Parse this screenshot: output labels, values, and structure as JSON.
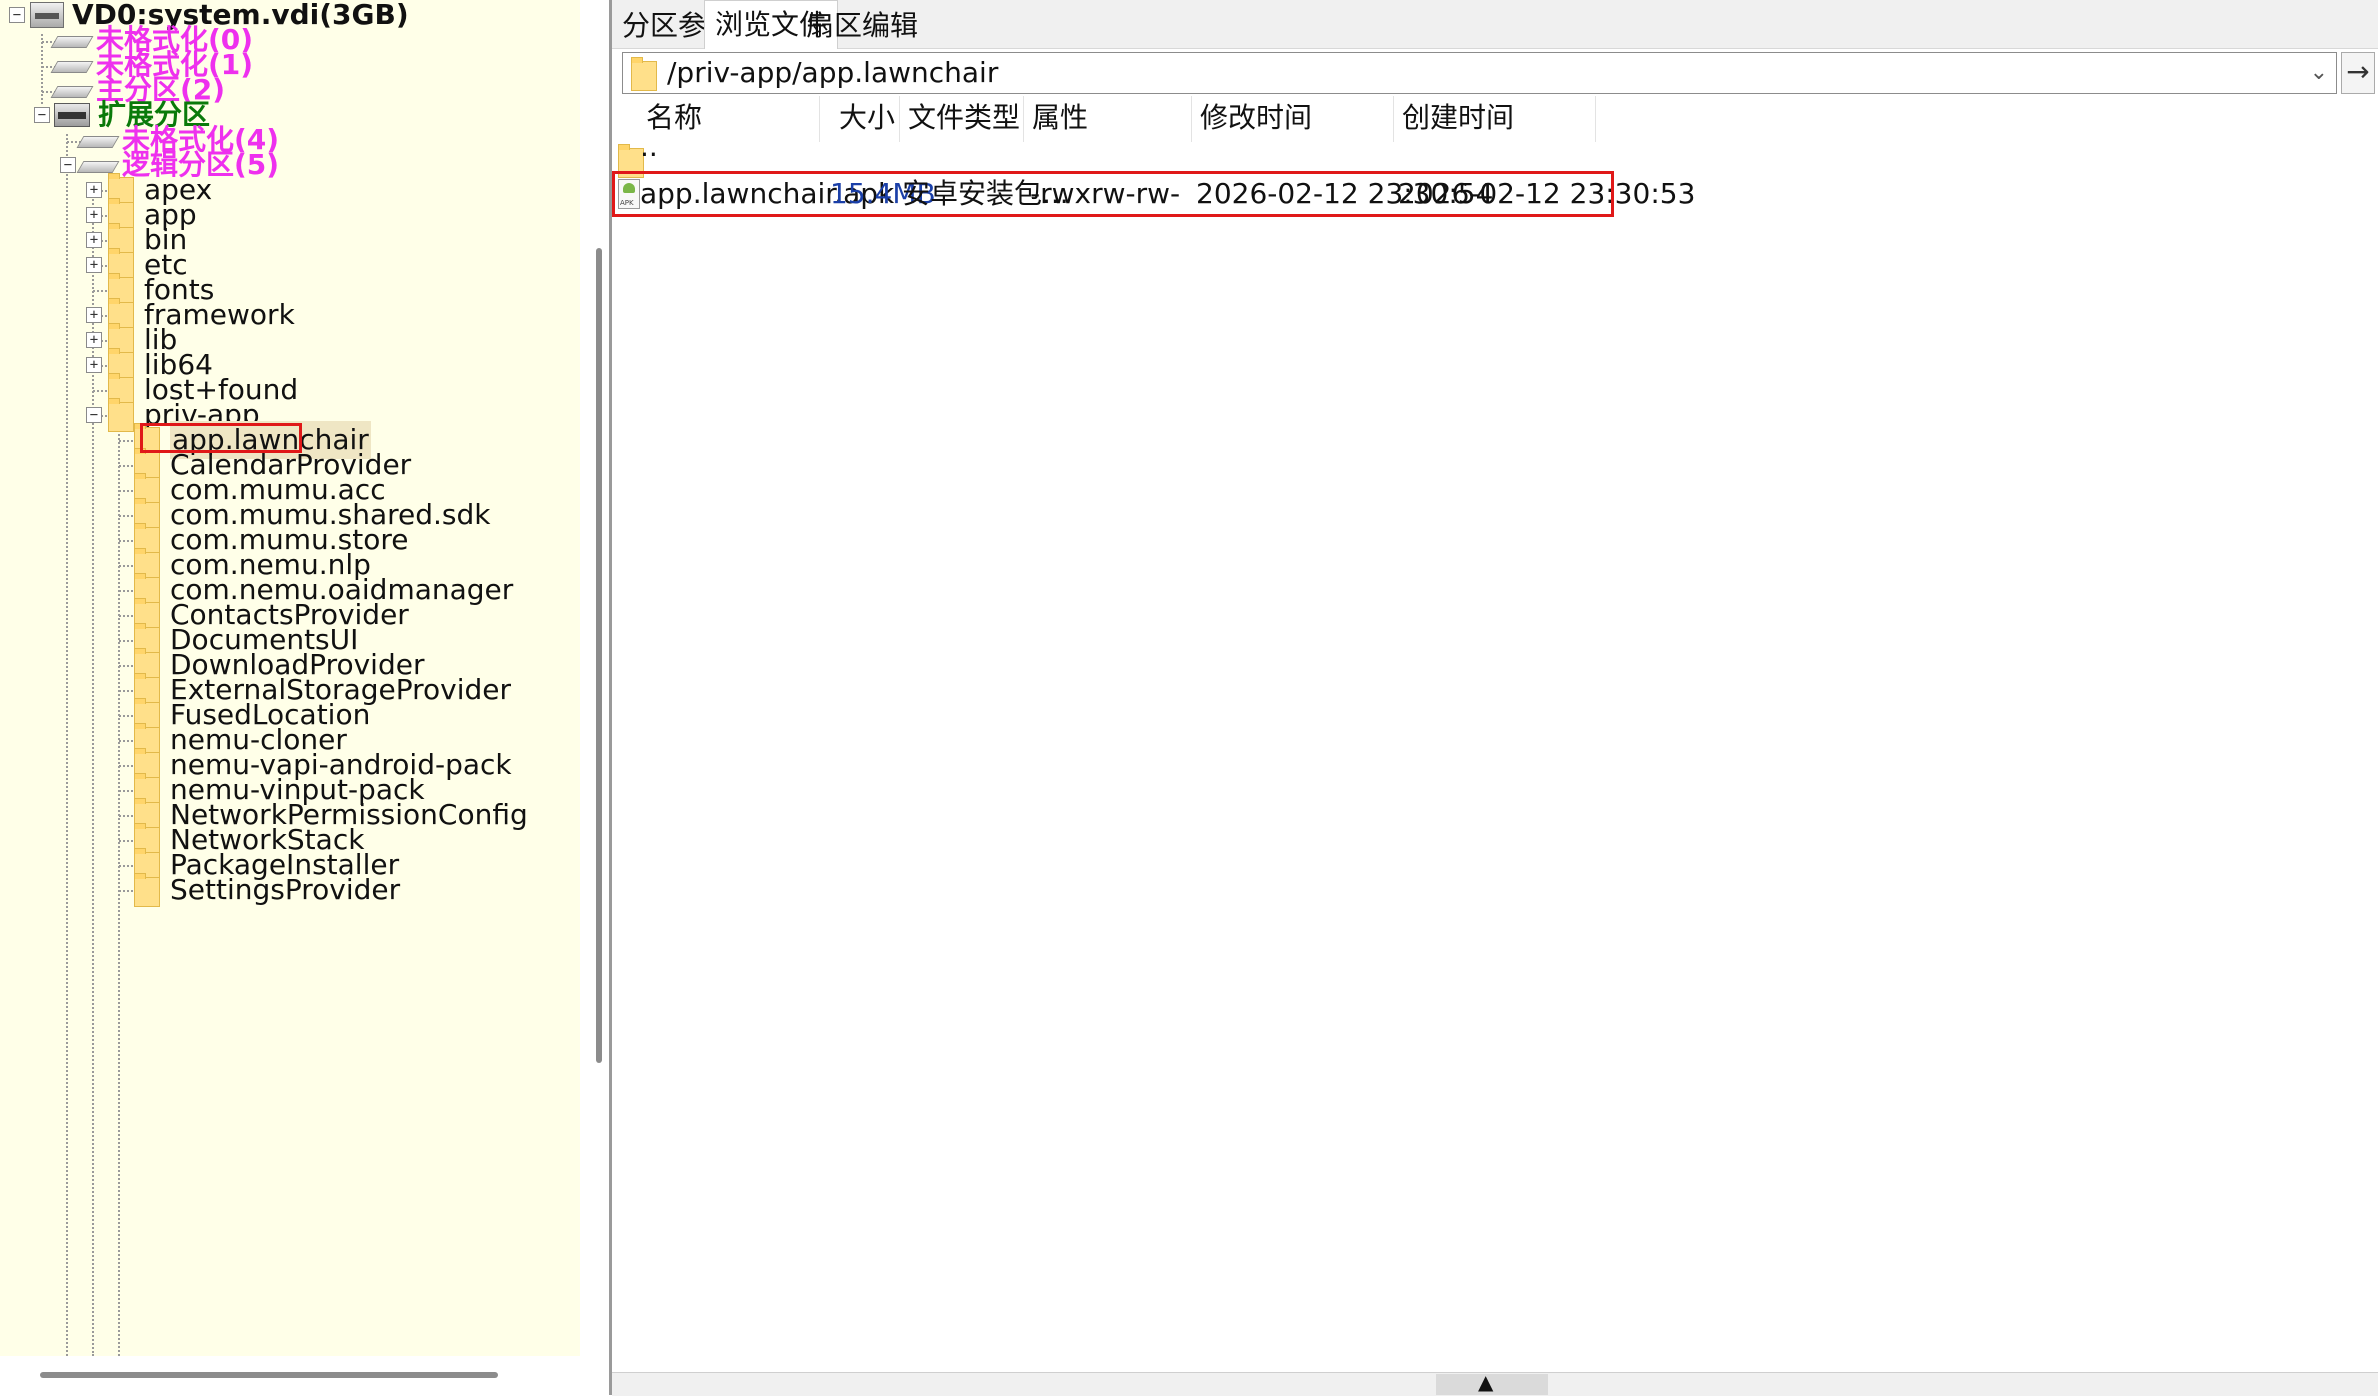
{
  "tree": {
    "root": "VD0:system.vdi(3GB)",
    "unformatted_0": "未格式化(0)",
    "unformatted_1": "未格式化(1)",
    "primary_2": "主分区(2)",
    "extended": "扩展分区",
    "unformatted_4": "未格式化(4)",
    "logical_5": "逻辑分区(5)",
    "folders": [
      "apex",
      "app",
      "bin",
      "etc",
      "fonts",
      "framework",
      "lib",
      "lib64",
      "lost+found",
      "priv-app"
    ],
    "priv_app_children": [
      "app.lawnchair",
      "CalendarProvider",
      "com.mumu.acc",
      "com.mumu.shared.sdk",
      "com.mumu.store",
      "com.nemu.nlp",
      "com.nemu.oaidmanager",
      "ContactsProvider",
      "DocumentsUI",
      "DownloadProvider",
      "ExternalStorageProvider",
      "FusedLocation",
      "nemu-cloner",
      "nemu-vapi-android-pack",
      "nemu-vinput-pack",
      "NetworkPermissionConfig",
      "NetworkStack",
      "PackageInstaller",
      "SettingsProvider"
    ]
  },
  "tabs": [
    "分区参数",
    "浏览文件",
    "扇区编辑"
  ],
  "active_tab": "浏览文件",
  "path": "/priv-app/app.lawnchair",
  "columns": [
    "名称",
    "大小",
    "文件类型",
    "属性",
    "修改时间",
    "创建时间"
  ],
  "parent_entry": "..",
  "files": [
    {
      "name": "app.lawnchair.apk",
      "size": "15.4MB",
      "type": "安卓安装包...",
      "attributes": "-rwxrw-rw-",
      "modified": "2026-02-12 23:30:54",
      "created": "2026-02-12 23:30:53"
    }
  ],
  "colors": {
    "tree_background": "#ffffe8",
    "partition_pink": "#ee30ee",
    "extended_green": "#0a7a0a",
    "size_blue": "#1a3fa8",
    "highlight_red": "#e01818",
    "folder_yellow": "#ffe08a"
  }
}
